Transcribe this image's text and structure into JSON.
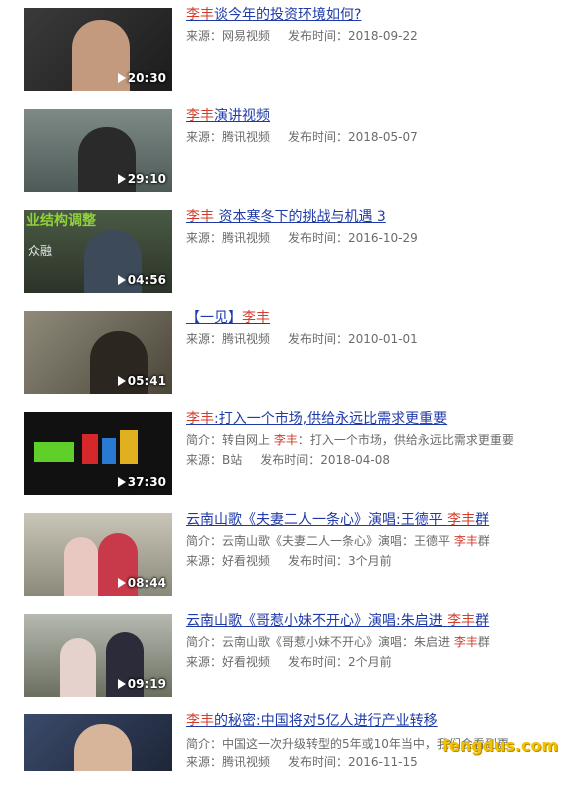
{
  "items": [
    {
      "title_hl": "李丰",
      "title_rest": "谈今年的投资环境如何?",
      "duration": "20:30",
      "source": "来源：网易视频",
      "date": "发布时间：2018-09-22"
    },
    {
      "title_hl": "李丰",
      "title_rest": "演讲视频",
      "duration": "29:10",
      "source": "来源：腾讯视频",
      "date": "发布时间：2018-05-07"
    },
    {
      "title_hl": "李丰",
      "title_rest": " 资本寒冬下的挑战与机遇 3",
      "duration": "04:56",
      "source": "来源：腾讯视频",
      "date": "发布时间：2016-10-29",
      "thumb_text": "业结构调整",
      "thumb_text2": "众融"
    },
    {
      "title_pre": "【一见】",
      "title_hl": "李丰",
      "duration": "05:41",
      "source": "来源：腾讯视频",
      "date": "发布时间：2010-01-01"
    },
    {
      "title_hl": "李丰",
      "title_rest": ":打入一个市场,供给永远比需求更重要",
      "duration": "37:30",
      "summary_pre": "简介：转自网上 ",
      "summary_hl": "李丰",
      "summary_post": "：打入一个市场，供给永远比需求更重要",
      "source": "来源：B站",
      "date": "发布时间：2018-04-08"
    },
    {
      "title_pre": "云南山歌《夫妻二人一条心》演唱:王德平 ",
      "title_hl": "李丰",
      "title_rest": "群",
      "duration": "08:44",
      "summary_pre": "简介：云南山歌《夫妻二人一条心》演唱：王德平 ",
      "summary_hl": "李丰",
      "summary_post": "群",
      "source": "来源：好看视频",
      "date": "发布时间：3个月前"
    },
    {
      "title_pre": "云南山歌《哥惹小妹不开心》演唱:朱启进 ",
      "title_hl": "李丰",
      "title_rest": "群",
      "duration": "09:19",
      "summary_pre": "简介：云南山歌《哥惹小妹不开心》演唱：朱启进 ",
      "summary_hl": "李丰",
      "summary_post": "群",
      "source": "来源：好看视频",
      "date": "发布时间：2个月前"
    },
    {
      "title_hl": "李丰",
      "title_rest": "的秘密:中国将对5亿人进行产业转移",
      "summary_pre": "简介：中国这一次升级转型的5年或10年当中，我们会看到更",
      "source": "来源：腾讯视频",
      "date": "发布时间：2016-11-15"
    }
  ],
  "watermark": "fengdus.com",
  "colors": {
    "link": "#1f3aa8",
    "highlight": "#d23d2e",
    "meta": "#6b6b6b"
  }
}
